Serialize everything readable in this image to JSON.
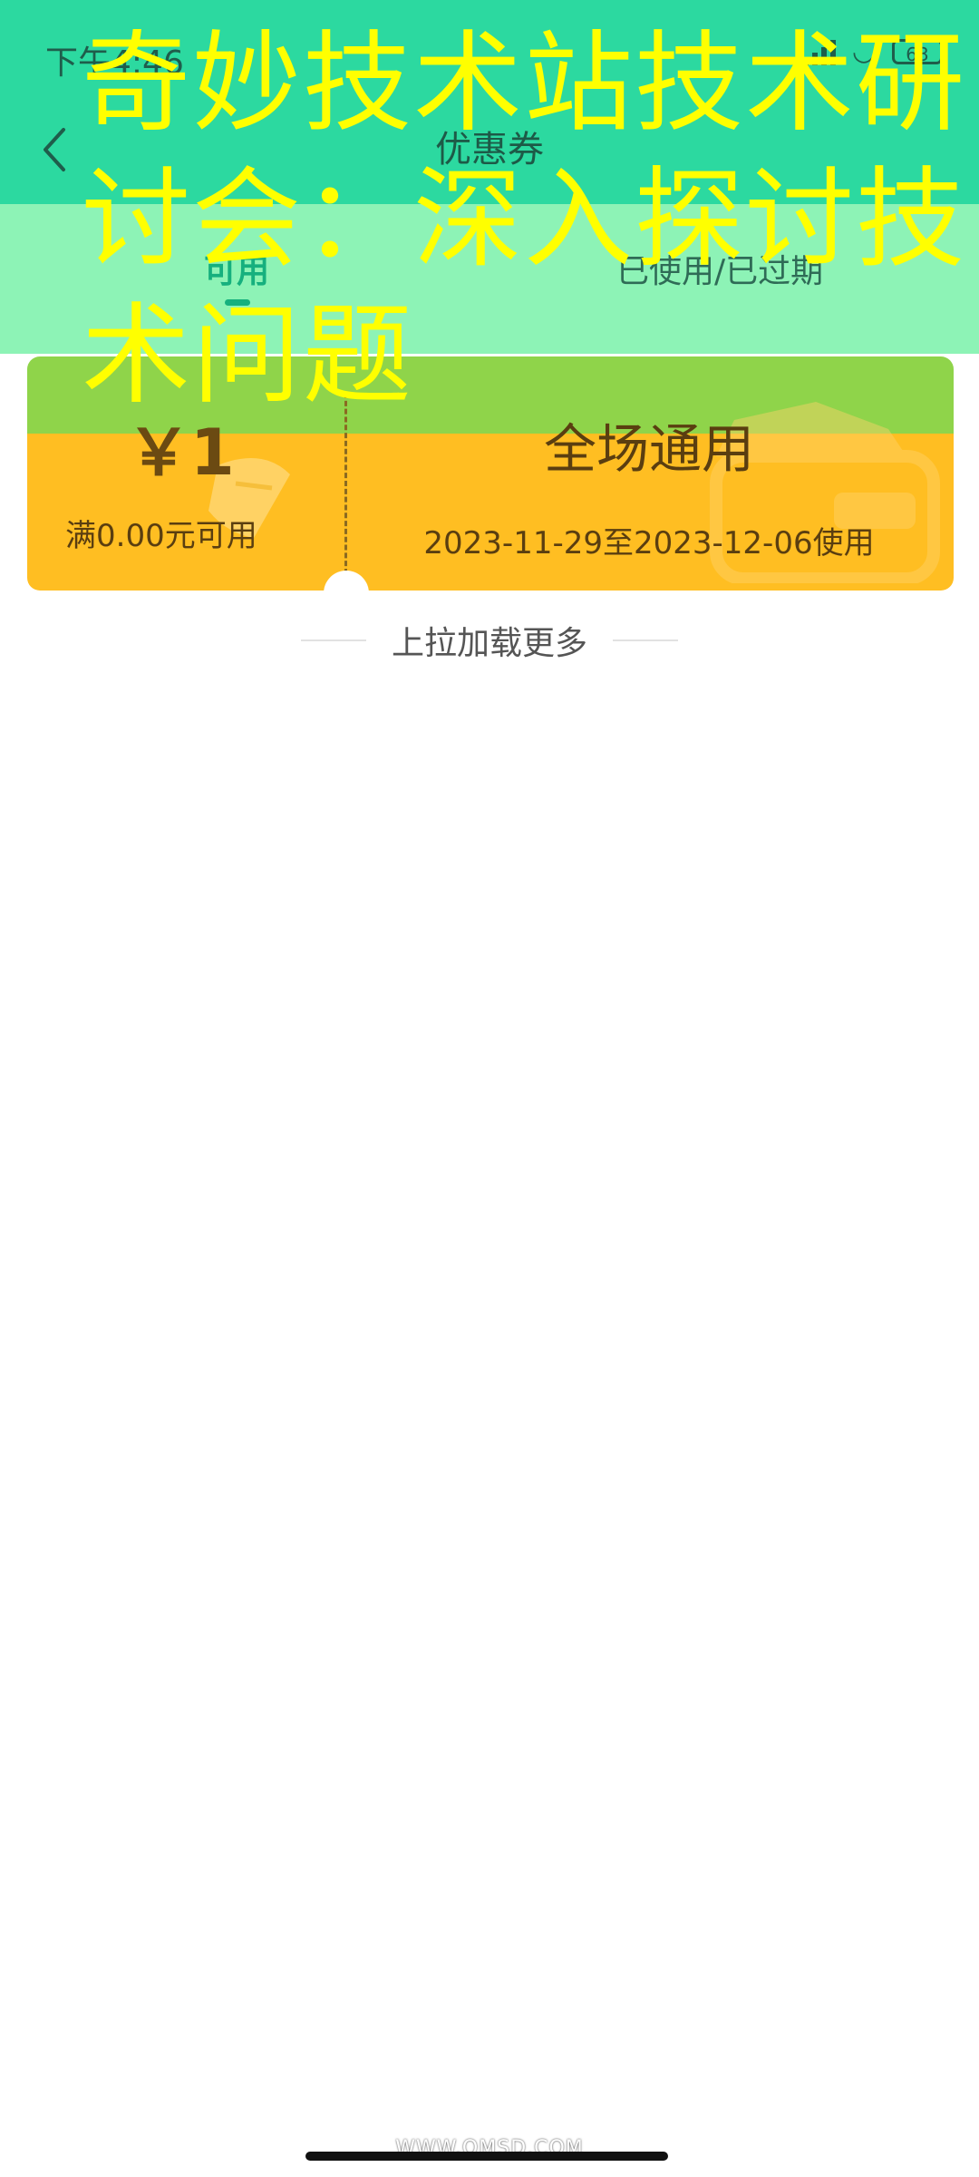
{
  "status_bar": {
    "time": "下午4:46",
    "battery": "63"
  },
  "header": {
    "title": "优惠券"
  },
  "tabs": [
    {
      "label": "可用",
      "active": true
    },
    {
      "label": "已使用/已过期",
      "active": false
    }
  ],
  "overlay": {
    "text": "奇妙技术站技术研讨会：深入探讨技术问题"
  },
  "coupon": {
    "amount": "￥1",
    "condition": "满0.00元可用",
    "title": "全场通用",
    "validity": "2023-11-29至2023-12-06使用"
  },
  "list": {
    "load_more": "上拉加载更多"
  },
  "footer": {
    "website": "WWW.QMSD.COM"
  },
  "colors": {
    "header_bg": "#2cd9a0",
    "tabs_bg": "#8df3b6",
    "overlay_text": "#ffff00",
    "coupon_band": "#8fd44a",
    "coupon_body": "#ffbe22",
    "active_tab": "#16b07e"
  },
  "icons": [
    "back-arrow-icon",
    "signal-icon",
    "wifi-icon",
    "battery-icon",
    "coupon-ticket-deco-icon",
    "coupon-wallet-deco-icon"
  ]
}
